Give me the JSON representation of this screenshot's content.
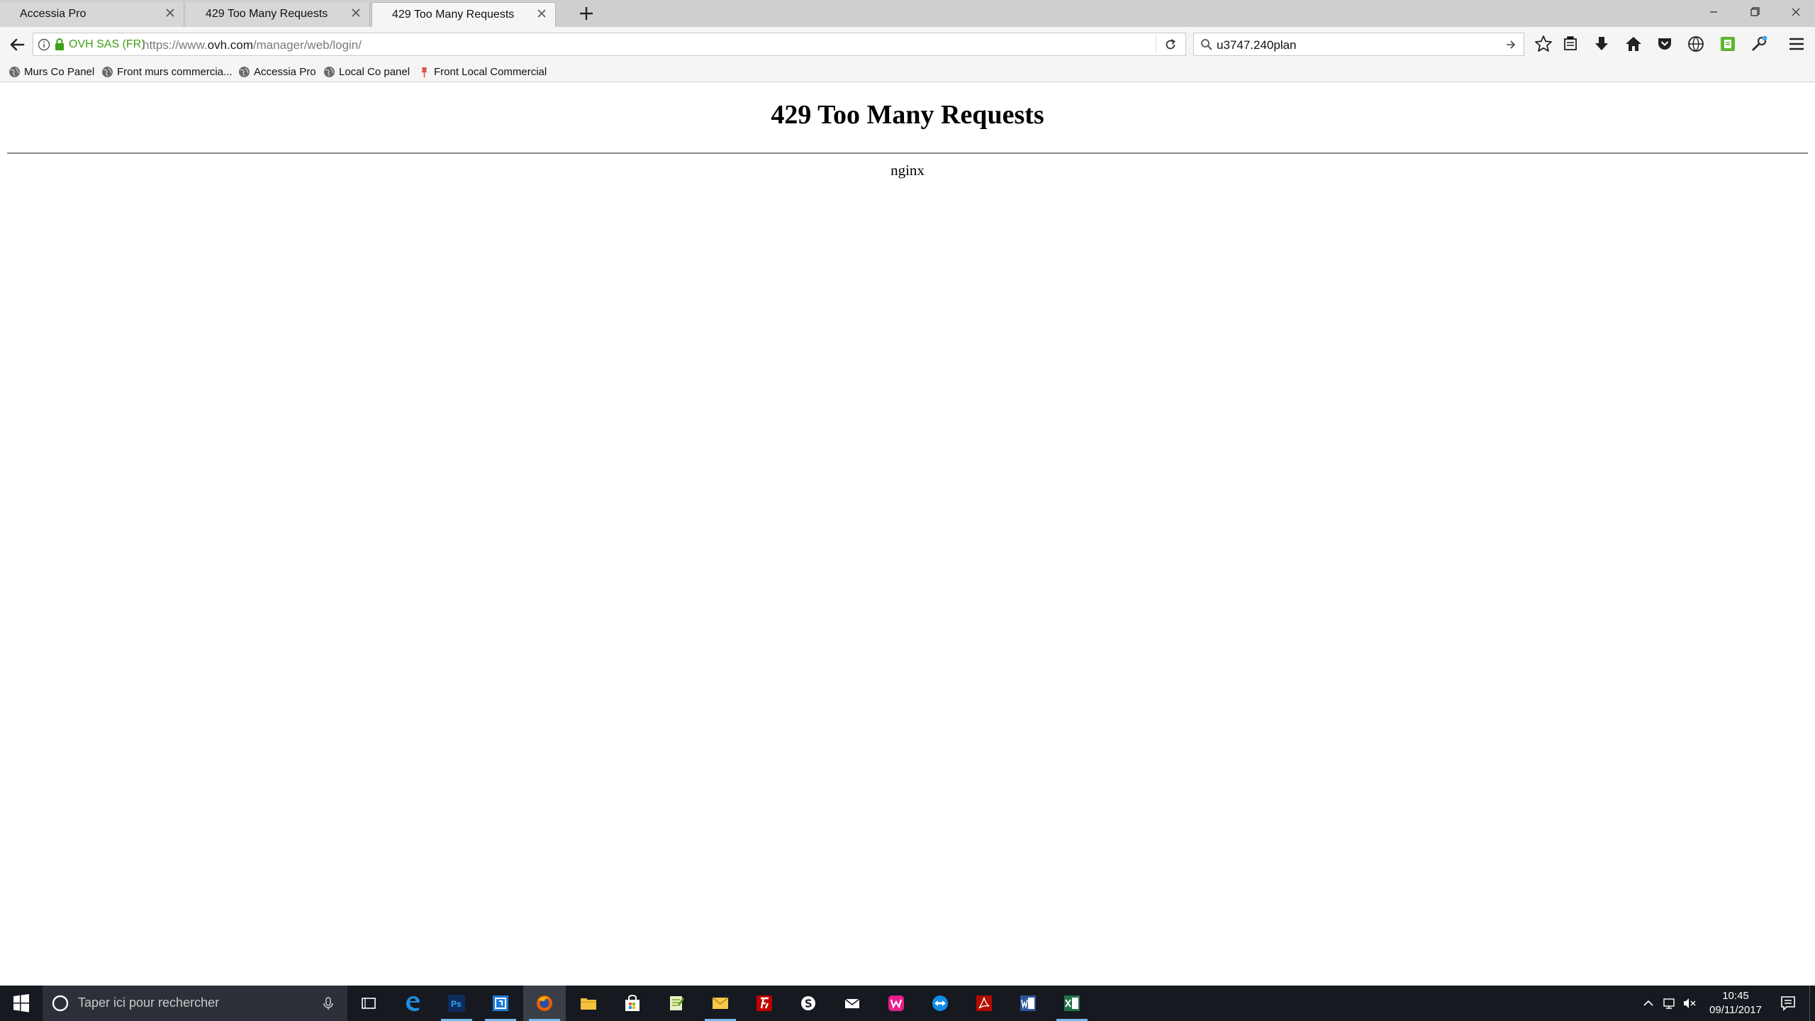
{
  "browser": {
    "tabs": [
      {
        "label": "Accessia Pro",
        "active": false
      },
      {
        "label": "429 Too Many Requests",
        "active": false
      },
      {
        "label": "429 Too Many Requests",
        "active": true
      }
    ],
    "url": {
      "identity": "OVH SAS (FR)",
      "prefix": "https://www.",
      "domain": "ovh.com",
      "path": "/manager/web/login/"
    },
    "search_value": "u3747.240plan",
    "bookmarks": [
      {
        "label": "Murs Co Panel",
        "icon": "globe-icon"
      },
      {
        "label": "Front murs commercia...",
        "icon": "globe-icon"
      },
      {
        "label": "Accessia Pro",
        "icon": "globe-icon"
      },
      {
        "label": "Local Co panel",
        "icon": "globe-icon"
      },
      {
        "label": "Front Local Commercial",
        "icon": "pin-icon"
      }
    ],
    "secure_color": "#3fa017"
  },
  "page": {
    "title": "429 Too Many Requests",
    "server": "nginx"
  },
  "taskbar": {
    "search_placeholder": "Taper ici pour rechercher",
    "apps": [
      "task-view",
      "edge",
      "photoshop",
      "remote-desktop",
      "firefox",
      "file-explorer",
      "store",
      "notepad-plus",
      "outlook",
      "filezilla",
      "skype",
      "mail",
      "wamp",
      "teamviewer",
      "acrobat",
      "word",
      "excel"
    ],
    "time": "10:45",
    "date": "09/11/2017",
    "accent": "#76b9ed"
  }
}
